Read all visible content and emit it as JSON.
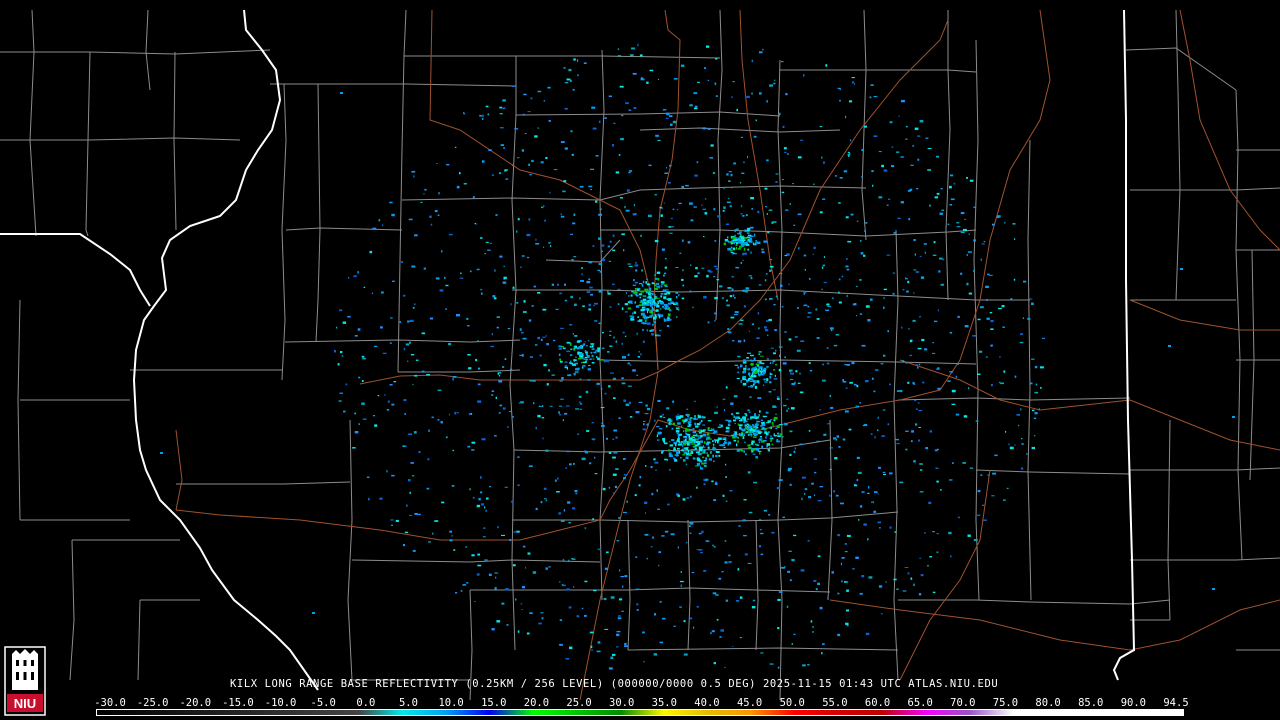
{
  "product": {
    "title": "KILX LONG RANGE BASE REFLECTIVITY (0.25KM / 256 LEVEL) (000000/0000 0.5 DEG) 2025-11-15 01:43 UTC  ATLAS.NIU.EDU"
  },
  "logo": {
    "text": "NIU",
    "name": "niu-logo"
  },
  "colors": {
    "background": "#000000",
    "county_border": "#8c8c8c",
    "state_border": "#ffffff",
    "road": "#a0522d"
  },
  "scale": {
    "labels": [
      "-30.0",
      "-25.0",
      "-20.0",
      "-15.0",
      "-10.0",
      "-5.0",
      "0.0",
      "5.0",
      "10.0",
      "15.0",
      "20.0",
      "25.0",
      "30.0",
      "35.0",
      "40.0",
      "45.0",
      "50.0",
      "55.0",
      "60.0",
      "65.0",
      "70.0",
      "75.0",
      "80.0",
      "85.0",
      "90.0",
      "94.5"
    ],
    "stops": [
      {
        "dbz": -30,
        "color": "#000000"
      },
      {
        "dbz": 0,
        "color": "#444444"
      },
      {
        "dbz": 5,
        "color": "#04e9e7"
      },
      {
        "dbz": 10,
        "color": "#019ff4"
      },
      {
        "dbz": 15,
        "color": "#0300f4"
      },
      {
        "dbz": 20,
        "color": "#02fd02"
      },
      {
        "dbz": 25,
        "color": "#01c501"
      },
      {
        "dbz": 30,
        "color": "#008e00"
      },
      {
        "dbz": 35,
        "color": "#fdf802"
      },
      {
        "dbz": 40,
        "color": "#e5bc00"
      },
      {
        "dbz": 45,
        "color": "#fd9500"
      },
      {
        "dbz": 50,
        "color": "#fd0000"
      },
      {
        "dbz": 55,
        "color": "#d40000"
      },
      {
        "dbz": 60,
        "color": "#bc0000"
      },
      {
        "dbz": 65,
        "color": "#f800fd"
      },
      {
        "dbz": 70,
        "color": "#9854c6"
      },
      {
        "dbz": 75,
        "color": "#fdfdfd"
      },
      {
        "dbz": 94.5,
        "color": "#ffffff"
      }
    ]
  }
}
